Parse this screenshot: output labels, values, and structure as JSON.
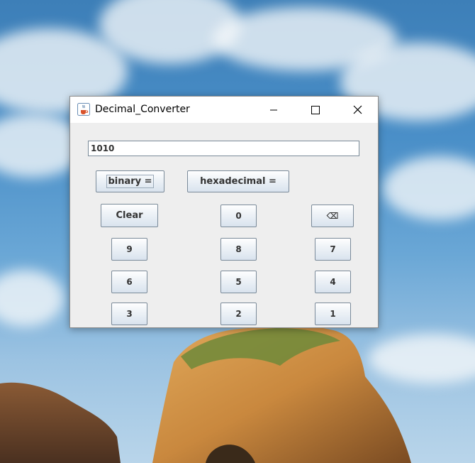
{
  "window": {
    "title": "Decimal_Converter",
    "controls": [
      "minimize-icon",
      "maximize-icon",
      "close-icon"
    ]
  },
  "display": {
    "value": "1010"
  },
  "buttons": {
    "binary": "binary =",
    "hexadecimal": "hexadecimal =",
    "clear": "Clear",
    "backspace": "⌫",
    "digits": {
      "d0": "0",
      "d1": "1",
      "d2": "2",
      "d3": "3",
      "d4": "4",
      "d5": "5",
      "d6": "6",
      "d7": "7",
      "d8": "8",
      "d9": "9"
    }
  }
}
